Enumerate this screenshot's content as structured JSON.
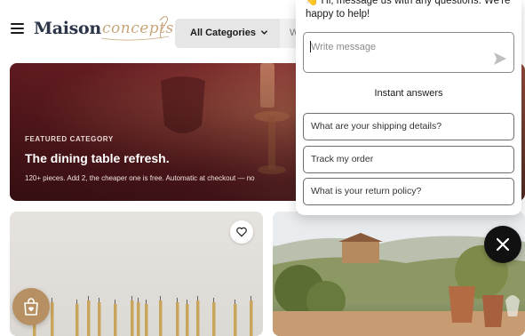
{
  "header": {
    "logo_main": "Maison",
    "logo_accent": "concepts",
    "category_select": "All Categories",
    "search_placeholder_partial": "W"
  },
  "featured": {
    "kicker": "FEATURED CATEGORY",
    "title": "The dining table refresh.",
    "description": "120+ pieces. Add 2, the cheaper one is free. Automatic at checkout — no"
  },
  "chat": {
    "greeting": "👋 Hi, message us with any questions. We're happy to help!",
    "input_placeholder": "Write message",
    "instant_answers_label": "Instant answers",
    "quick_replies": [
      "What are your shipping details?",
      "Track my order",
      "What is your return policy?"
    ]
  },
  "colors": {
    "brand_navy": "#2c3548",
    "brand_gold": "#c7a67c",
    "featured_bg": "#6e2026",
    "wishlist_fab": "#b69062",
    "close_fab": "#111111"
  },
  "icons": [
    "hamburger-icon",
    "chevron-down-icon",
    "heart-icon",
    "shopping-bag-heart-icon",
    "send-icon",
    "close-icon"
  ]
}
